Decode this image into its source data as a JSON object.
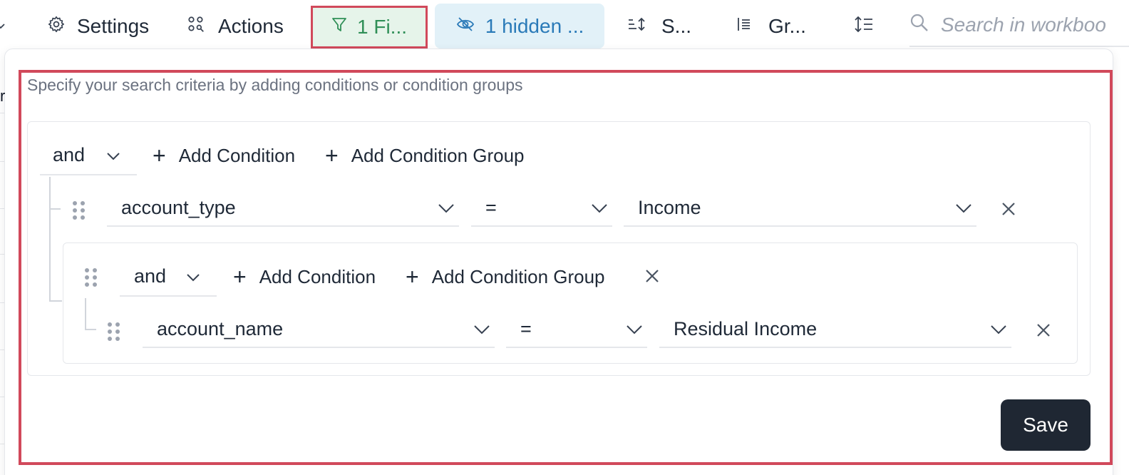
{
  "toolbar": {
    "settings_label": "Settings",
    "actions_label": "Actions",
    "filter_label": "1 Fi...",
    "hidden_label": "1 hidden ...",
    "sort_label": "S...",
    "group_label": "Gr...",
    "search_placeholder": "Search in workboo",
    "colors": {
      "filter_bg": "#e6f4ea",
      "filter_fg": "#2f8f57",
      "hidden_bg": "#e2f1f8",
      "hidden_fg": "#2a7ab8",
      "highlight": "#d1495b"
    }
  },
  "background": {
    "partial_text": "r"
  },
  "filter_panel": {
    "hint": "Specify your search criteria by adding conditions or condition groups",
    "root_group": {
      "operator": "and",
      "add_condition_label": "Add Condition",
      "add_group_label": "Add Condition Group",
      "condition": {
        "field": "account_type",
        "comparator": "=",
        "value": "Income"
      },
      "nested_group": {
        "operator": "and",
        "add_condition_label": "Add Condition",
        "add_group_label": "Add Condition Group",
        "condition": {
          "field": "account_name",
          "comparator": "=",
          "value": "Residual Income"
        }
      }
    },
    "save_label": "Save"
  }
}
